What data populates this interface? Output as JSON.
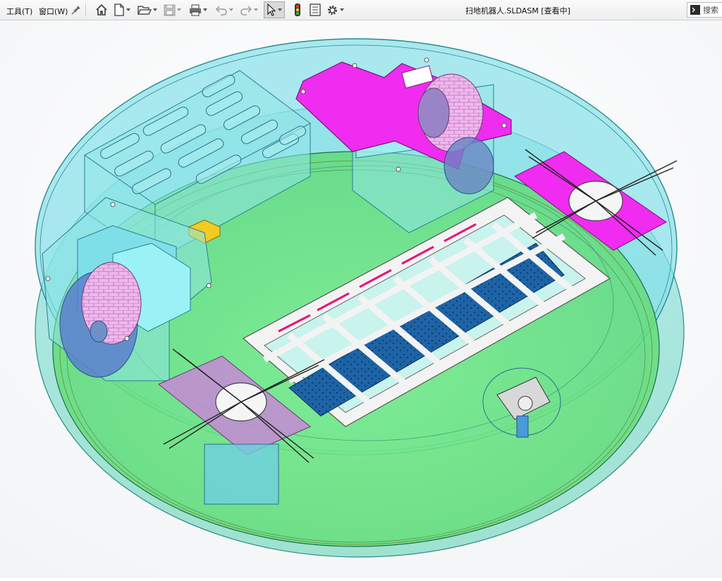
{
  "menubar": {
    "tools_label": "工具(T)",
    "window_label": "窗口(W)"
  },
  "toolbar": {
    "icons": [
      "home-icon",
      "new-document-icon",
      "open-folder-icon",
      "save-icon",
      "print-icon",
      "undo-icon",
      "redo-icon",
      "select-cursor-icon",
      "traffic-light-icon",
      "file-properties-icon",
      "gear-icon"
    ]
  },
  "document": {
    "title": "扫地机器人.SLDASM [查看中]"
  },
  "search": {
    "label": "搜索"
  },
  "heads_up_toolbar": {
    "icons": [
      "zoom-to-fit-icon",
      "zoom-area-icon",
      "previous-view-icon",
      "section-view-icon",
      "view-orientation-icon",
      "display-style-icon",
      "hide-show-items-icon",
      "edit-appearance-icon",
      "apply-scene-icon",
      "view-settings-icon"
    ]
  },
  "colors": {
    "body_shell": "#7fdede",
    "base_plate": "#74e68a",
    "bracket_magenta": "#ef2cf0",
    "wheel_pink": "#e8a7e6",
    "brush_blue": "#1f5f9e",
    "sensor_yellow": "#f2cc24",
    "frame_white": "#f3f3f3"
  }
}
